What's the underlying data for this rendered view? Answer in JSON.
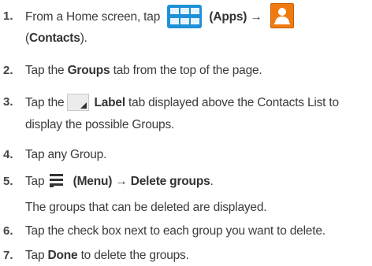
{
  "steps": [
    {
      "num": "1.",
      "line1_prefix": "From a Home screen, tap",
      "apps_label": "(Apps)",
      "arrow": "→",
      "contacts_label": "Contacts",
      "apps_icon": "apps-grid-icon",
      "contacts_icon": "contacts-icon"
    },
    {
      "num": "2.",
      "pre": "Tap the",
      "bold": "Groups",
      "post": "tab from the top of the page."
    },
    {
      "num": "3.",
      "pre": "Tap the",
      "bold": "Label",
      "post": "tab displayed above the Contacts List to",
      "line2": "display the possible Groups.",
      "icon": "label-tab-icon"
    },
    {
      "num": "4.",
      "text": "Tap any Group."
    },
    {
      "num": "5.",
      "pre": "Tap",
      "menu_label": "(Menu)",
      "arrow": "→",
      "bold": "Delete groups",
      "post": ".",
      "note": "The groups that can be deleted are displayed.",
      "icon": "menu-icon"
    },
    {
      "num": "6.",
      "text": "Tap the check box next to each group you want to delete."
    },
    {
      "num": "7.",
      "pre": "Tap",
      "bold": "Done",
      "post": "to delete the groups."
    }
  ],
  "colors": {
    "apps_icon": "#1e90d8",
    "contacts_icon": "#f07a10"
  }
}
